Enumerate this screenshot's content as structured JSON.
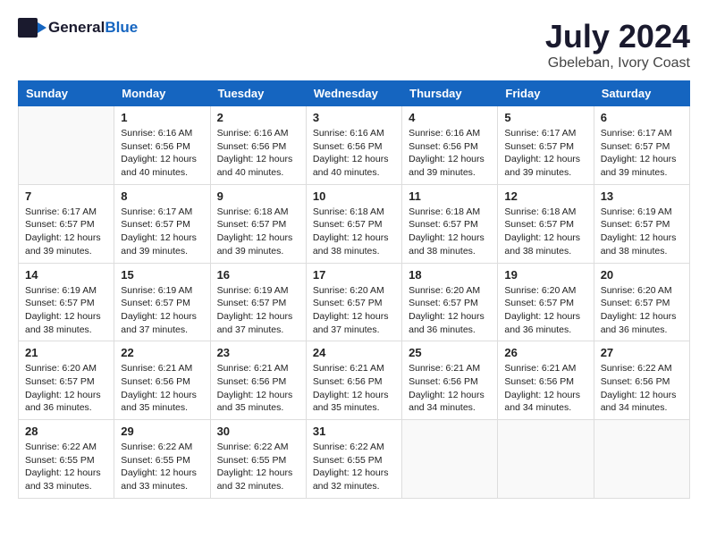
{
  "header": {
    "logo_general": "General",
    "logo_blue": "Blue",
    "month": "July 2024",
    "location": "Gbeleban, Ivory Coast"
  },
  "days_of_week": [
    "Sunday",
    "Monday",
    "Tuesday",
    "Wednesday",
    "Thursday",
    "Friday",
    "Saturday"
  ],
  "weeks": [
    [
      {
        "day": "",
        "info": ""
      },
      {
        "day": "1",
        "info": "Sunrise: 6:16 AM\nSunset: 6:56 PM\nDaylight: 12 hours\nand 40 minutes."
      },
      {
        "day": "2",
        "info": "Sunrise: 6:16 AM\nSunset: 6:56 PM\nDaylight: 12 hours\nand 40 minutes."
      },
      {
        "day": "3",
        "info": "Sunrise: 6:16 AM\nSunset: 6:56 PM\nDaylight: 12 hours\nand 40 minutes."
      },
      {
        "day": "4",
        "info": "Sunrise: 6:16 AM\nSunset: 6:56 PM\nDaylight: 12 hours\nand 39 minutes."
      },
      {
        "day": "5",
        "info": "Sunrise: 6:17 AM\nSunset: 6:57 PM\nDaylight: 12 hours\nand 39 minutes."
      },
      {
        "day": "6",
        "info": "Sunrise: 6:17 AM\nSunset: 6:57 PM\nDaylight: 12 hours\nand 39 minutes."
      }
    ],
    [
      {
        "day": "7",
        "info": ""
      },
      {
        "day": "8",
        "info": "Sunrise: 6:17 AM\nSunset: 6:57 PM\nDaylight: 12 hours\nand 39 minutes."
      },
      {
        "day": "9",
        "info": "Sunrise: 6:18 AM\nSunset: 6:57 PM\nDaylight: 12 hours\nand 39 minutes."
      },
      {
        "day": "10",
        "info": "Sunrise: 6:18 AM\nSunset: 6:57 PM\nDaylight: 12 hours\nand 38 minutes."
      },
      {
        "day": "11",
        "info": "Sunrise: 6:18 AM\nSunset: 6:57 PM\nDaylight: 12 hours\nand 38 minutes."
      },
      {
        "day": "12",
        "info": "Sunrise: 6:18 AM\nSunset: 6:57 PM\nDaylight: 12 hours\nand 38 minutes."
      },
      {
        "day": "13",
        "info": "Sunrise: 6:19 AM\nSunset: 6:57 PM\nDaylight: 12 hours\nand 38 minutes."
      }
    ],
    [
      {
        "day": "14",
        "info": ""
      },
      {
        "day": "15",
        "info": "Sunrise: 6:19 AM\nSunset: 6:57 PM\nDaylight: 12 hours\nand 37 minutes."
      },
      {
        "day": "16",
        "info": "Sunrise: 6:19 AM\nSunset: 6:57 PM\nDaylight: 12 hours\nand 37 minutes."
      },
      {
        "day": "17",
        "info": "Sunrise: 6:20 AM\nSunset: 6:57 PM\nDaylight: 12 hours\nand 37 minutes."
      },
      {
        "day": "18",
        "info": "Sunrise: 6:20 AM\nSunset: 6:57 PM\nDaylight: 12 hours\nand 36 minutes."
      },
      {
        "day": "19",
        "info": "Sunrise: 6:20 AM\nSunset: 6:57 PM\nDaylight: 12 hours\nand 36 minutes."
      },
      {
        "day": "20",
        "info": "Sunrise: 6:20 AM\nSunset: 6:57 PM\nDaylight: 12 hours\nand 36 minutes."
      }
    ],
    [
      {
        "day": "21",
        "info": ""
      },
      {
        "day": "22",
        "info": "Sunrise: 6:21 AM\nSunset: 6:56 PM\nDaylight: 12 hours\nand 35 minutes."
      },
      {
        "day": "23",
        "info": "Sunrise: 6:21 AM\nSunset: 6:56 PM\nDaylight: 12 hours\nand 35 minutes."
      },
      {
        "day": "24",
        "info": "Sunrise: 6:21 AM\nSunset: 6:56 PM\nDaylight: 12 hours\nand 35 minutes."
      },
      {
        "day": "25",
        "info": "Sunrise: 6:21 AM\nSunset: 6:56 PM\nDaylight: 12 hours\nand 34 minutes."
      },
      {
        "day": "26",
        "info": "Sunrise: 6:21 AM\nSunset: 6:56 PM\nDaylight: 12 hours\nand 34 minutes."
      },
      {
        "day": "27",
        "info": "Sunrise: 6:22 AM\nSunset: 6:56 PM\nDaylight: 12 hours\nand 34 minutes."
      }
    ],
    [
      {
        "day": "28",
        "info": "Sunrise: 6:22 AM\nSunset: 6:55 PM\nDaylight: 12 hours\nand 33 minutes."
      },
      {
        "day": "29",
        "info": "Sunrise: 6:22 AM\nSunset: 6:55 PM\nDaylight: 12 hours\nand 33 minutes."
      },
      {
        "day": "30",
        "info": "Sunrise: 6:22 AM\nSunset: 6:55 PM\nDaylight: 12 hours\nand 32 minutes."
      },
      {
        "day": "31",
        "info": "Sunrise: 6:22 AM\nSunset: 6:55 PM\nDaylight: 12 hours\nand 32 minutes."
      },
      {
        "day": "",
        "info": ""
      },
      {
        "day": "",
        "info": ""
      },
      {
        "day": "",
        "info": ""
      }
    ]
  ],
  "week7_sunday": "Sunrise: 6:17 AM\nSunset: 6:57 PM\nDaylight: 12 hours\nand 39 minutes.",
  "week14_sunday": "Sunrise: 6:19 AM\nSunset: 6:57 PM\nDaylight: 12 hours\nand 38 minutes.",
  "week21_sunday": "Sunrise: 6:20 AM\nSunset: 6:57 PM\nDaylight: 12 hours\nand 36 minutes."
}
